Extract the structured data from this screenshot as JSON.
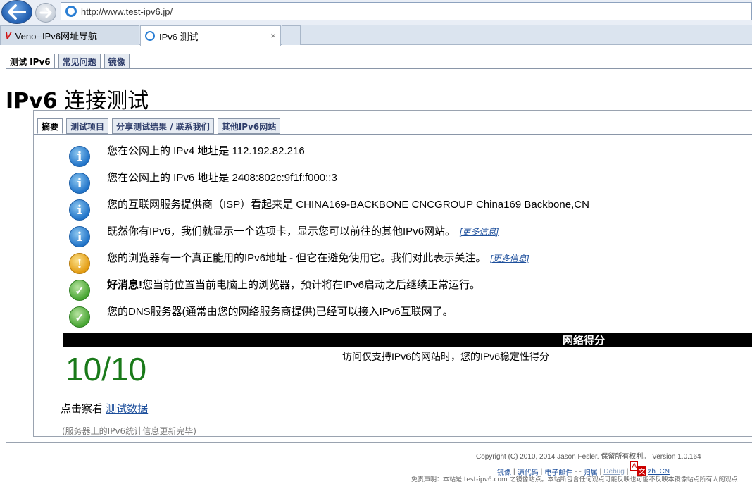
{
  "browser": {
    "address": "http://www.test-ipv6.jp/",
    "tabs": [
      {
        "label": "Veno--IPv6网址导航"
      },
      {
        "label": "IPv6 测试",
        "close": "×"
      }
    ]
  },
  "top_tabs": [
    "测试 IPv6",
    "常见问题",
    "镜像"
  ],
  "title": {
    "ipv6": "IPv6",
    "rest": " 连接测试"
  },
  "inner_tabs": [
    "摘要",
    "测试项目",
    "分享测试结果 / 联系我们",
    "其他IPv6网站"
  ],
  "results": [
    {
      "type": "info",
      "text": "您在公网上的 IPv4 地址是 112.192.82.216"
    },
    {
      "type": "info",
      "text": "您在公网上的 IPv6 地址是 2408:802c:9f1f:f000::3"
    },
    {
      "type": "info",
      "text": "您的互联网服务提供商（ISP）看起来是 CHINA169-BACKBONE CNCGROUP China169 Backbone,CN"
    },
    {
      "type": "info",
      "text": "既然你有IPv6，我们就显示一个选项卡，显示您可以前往的其他IPv6网站。",
      "more": "[更多信息]"
    },
    {
      "type": "warn",
      "text": "您的浏览器有一个真正能用的IPv6地址 - 但它在避免使用它。我们对此表示关注。",
      "more": "[更多信息]"
    },
    {
      "type": "ok",
      "bold": "好消息!",
      "text": "您当前位置当前电脑上的浏览器，预计将在IPv6启动之后继续正常运行。"
    },
    {
      "type": "ok",
      "text": "您的DNS服务器(通常由您的网络服务商提供)已经可以接入IPv6互联网了。"
    }
  ],
  "icons": {
    "info": "i",
    "warn": "!",
    "ok": "✓"
  },
  "score": {
    "header": "网络得分",
    "value": "10/10",
    "desc": "访问仅支持IPv6的网站时，您的IPv6稳定性得分"
  },
  "click_view": {
    "prefix": "点击察看 ",
    "link": "测试数据"
  },
  "server_info": "(服务器上的IPv6统计信息更新完毕)",
  "footer": {
    "copyright": "Copyright (C) 2010, 2014 Jason Fesler. 保留所有权利。 Version 1.0.164",
    "links": [
      "镜像",
      "源代码",
      "电子邮件",
      "归属",
      "Debug",
      "zh_CN"
    ],
    "disclaimer": "免责声明：本站是 test-ipv6.com 之镜像站点。本站所包含任何观点可能反映也可能不反映本镜像站点所有人的观点"
  }
}
